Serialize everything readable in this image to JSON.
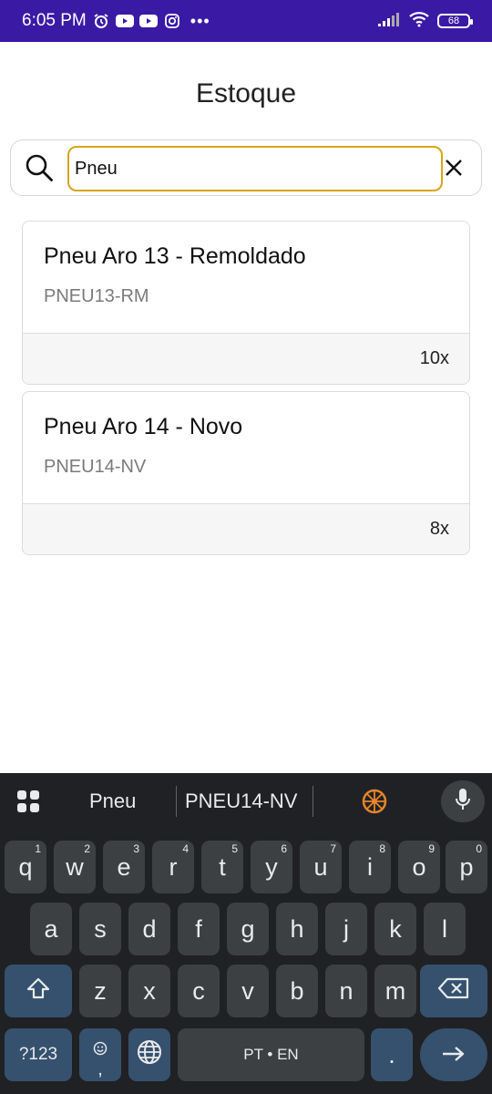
{
  "status_bar": {
    "time": "6:05 PM",
    "battery": "68"
  },
  "page": {
    "title": "Estoque"
  },
  "search": {
    "value": "Pneu",
    "placeholder": ""
  },
  "results": [
    {
      "name": "Pneu Aro 13 - Remoldado",
      "code": "PNEU13-RM",
      "quantity": "10x"
    },
    {
      "name": "Pneu Aro 14 - Novo",
      "code": "PNEU14-NV",
      "quantity": "8x"
    }
  ],
  "keyboard": {
    "suggestions": [
      "Pneu",
      "PNEU14-NV"
    ],
    "row1": [
      "q",
      "w",
      "e",
      "r",
      "t",
      "y",
      "u",
      "i",
      "o",
      "p"
    ],
    "row1_hints": [
      "1",
      "2",
      "3",
      "4",
      "5",
      "6",
      "7",
      "8",
      "9",
      "0"
    ],
    "row2": [
      "a",
      "s",
      "d",
      "f",
      "g",
      "h",
      "j",
      "k",
      "l"
    ],
    "row3": [
      "z",
      "x",
      "c",
      "v",
      "b",
      "n",
      "m"
    ],
    "symbols_label": "?123",
    "emoji_comma": ",",
    "space_label": "PT • EN",
    "period": "."
  },
  "colors": {
    "status_bar": "#3a1aa5",
    "search_focus": "#d9a419",
    "keyboard_bg": "#202124",
    "key_bg": "#3c4043",
    "func_key_bg": "#35516e"
  }
}
